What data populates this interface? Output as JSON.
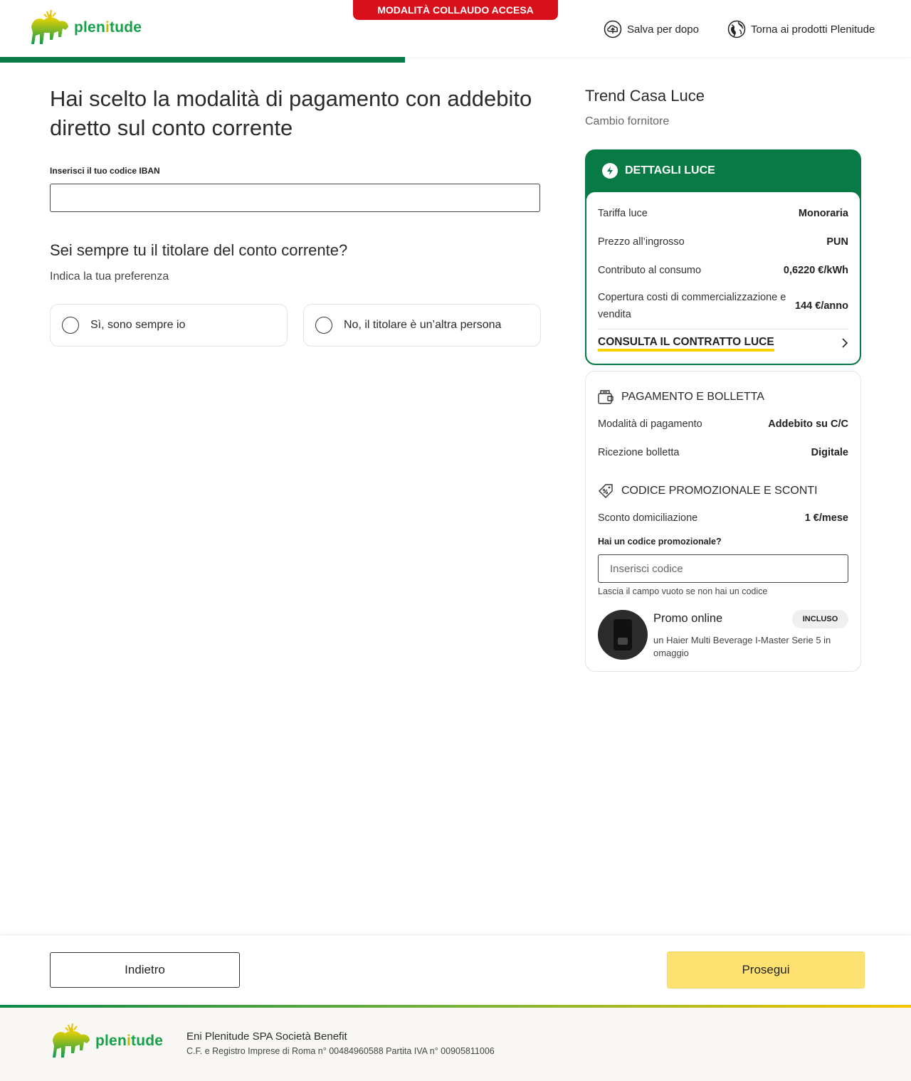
{
  "brand": {
    "logo_text_a": "plen",
    "logo_text_b": "i",
    "logo_text_c": "tude"
  },
  "header": {
    "collaudo_banner": "MODALITÀ COLLAUDO ACCESA",
    "save_label": "Salva per dopo",
    "back_products_label": "Torna ai prodotti Plenitude"
  },
  "main": {
    "title": "Hai scelto la modalità di pagamento con addebito diretto sul conto corrente",
    "iban_label": "Inserisci il tuo codice IBAN",
    "iban_value": "",
    "question_title": "Sei sempre tu il titolare del conto corrente?",
    "question_sub": "Indica la tua preferenza",
    "options": [
      {
        "label": "Sì, sono sempre io"
      },
      {
        "label": "No, il titolare è un’altra persona"
      }
    ]
  },
  "summary": {
    "product_title": "Trend Casa Luce",
    "product_sub": "Cambio fornitore",
    "luce": {
      "header": "DETTAGLI LUCE",
      "rows": [
        {
          "label": "Tariffa luce",
          "value": "Monoraria"
        },
        {
          "label": "Prezzo all’ingrosso",
          "value": "PUN"
        },
        {
          "label": "Contributo al consumo",
          "value": "0,6220 €/kWh"
        },
        {
          "label": "Copertura costi di commercializzazione e vendita",
          "value": "144 €/anno"
        }
      ],
      "contract_link": "CONSULTA IL CONTRATTO LUCE"
    },
    "payment": {
      "header": "PAGAMENTO E BOLLETTA",
      "rows": [
        {
          "label": "Modalità di pagamento",
          "value": "Addebito su C/C"
        },
        {
          "label": "Ricezione bolletta",
          "value": "Digitale"
        }
      ]
    },
    "promo": {
      "header": "CODICE PROMOZIONALE E SCONTI",
      "discount_label": "Sconto domiciliazione",
      "discount_value": "1 €/mese",
      "code_label": "Hai un codice promozionale?",
      "code_placeholder": "Inserisci codice",
      "code_hint": "Lascia il campo vuoto se non hai un codice",
      "offer_title": "Promo online",
      "offer_badge": "INCLUSO",
      "offer_desc": "un Haier Multi Beverage I-Master Serie 5 in omaggio"
    }
  },
  "actions": {
    "back_label": "Indietro",
    "next_label": "Prosegui"
  },
  "footer": {
    "company": "Eni Plenitude SPA Società Benefit",
    "info": "C.F. e Registro Imprese di Roma n° 00484960588 Partita IVA n° 00905811006"
  },
  "colors": {
    "brand_green": "#087a45",
    "banner_red": "#d9101c",
    "cta_yellow": "#fde272",
    "link_underline": "#f7d000"
  },
  "icons": [
    "plenitude-logo-icon",
    "cloud-upload-icon",
    "globe-icon",
    "lightning-icon",
    "chevron-right-icon",
    "wallet-icon",
    "tag-percent-icon"
  ]
}
